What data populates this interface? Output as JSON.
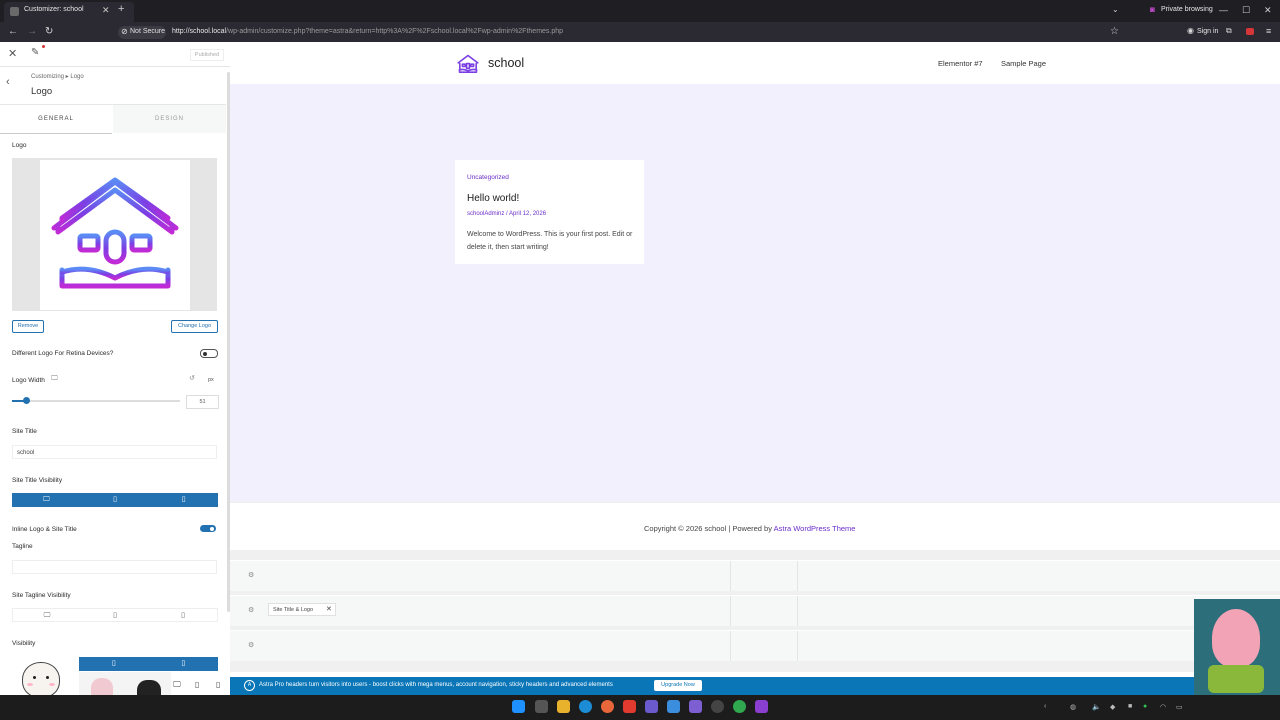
{
  "browser": {
    "tab_title": "Customizer: school",
    "tab_close": "✕",
    "new_tab": "+",
    "private_label": "Private browsing",
    "not_secure": "Not Secure",
    "url_host": "http://school.local",
    "url_path": "/wp-admin/customize.php?theme=astra&return=http%3A%2F%2Fschool.local%2Fwp-admin%2Fthemes.php",
    "sign_in": "Sign in"
  },
  "customizer": {
    "published_label": "Published",
    "breadcrumb": "Customizing ▸ Logo",
    "section_title": "Logo",
    "tabs": {
      "general": "GENERAL",
      "design": "DESIGN"
    },
    "logo_label": "Logo",
    "remove_button": "Remove",
    "change_logo_button": "Change Logo",
    "retina_label": "Different Logo For Retina Devices?",
    "retina_enabled": false,
    "logo_width_label": "Logo Width",
    "logo_width_unit": "px",
    "logo_width_value": "51",
    "site_title_label": "Site Title",
    "site_title_value": "school",
    "site_title_visibility_label": "Site Title Visibility",
    "inline_logo_label": "Inline Logo & Site Title",
    "inline_logo_enabled": true,
    "tagline_label": "Tagline",
    "tagline_value": "",
    "tagline_visibility_label": "Site Tagline Visibility",
    "visibility_label": "Visibility"
  },
  "site": {
    "title": "school",
    "menu": [
      "Elementor #7",
      "Sample Page"
    ],
    "post": {
      "category": "Uncategorized",
      "title": "Hello world!",
      "meta": "schoolAdminz / April 12, 2026",
      "excerpt": "Welcome to WordPress. This is your first post. Edit or delete it, then start writing!"
    },
    "footer_text": "Copyright © 2026 school | Powered by ",
    "footer_link": "Astra WordPress Theme"
  },
  "builder": {
    "chip_label": "Site Title & Logo",
    "chip_remove": "✕"
  },
  "notice": {
    "text": "Astra Pro headers turn visitors into users - boost clicks with mega menus, account navigation, sticky headers and advanced elements",
    "button": "Upgrade Now"
  },
  "colors": {
    "wp_blue": "#2271b1",
    "brand_purple": "#6b2fc9",
    "preview_bg": "#f2f0fc",
    "notice_bg": "#0a76b8"
  },
  "icons": [
    "close-icon",
    "pencil-icon",
    "back-icon",
    "desktop-icon",
    "tablet-icon",
    "mobile-icon",
    "reset-icon",
    "gear-icon",
    "school-logo-icon"
  ]
}
